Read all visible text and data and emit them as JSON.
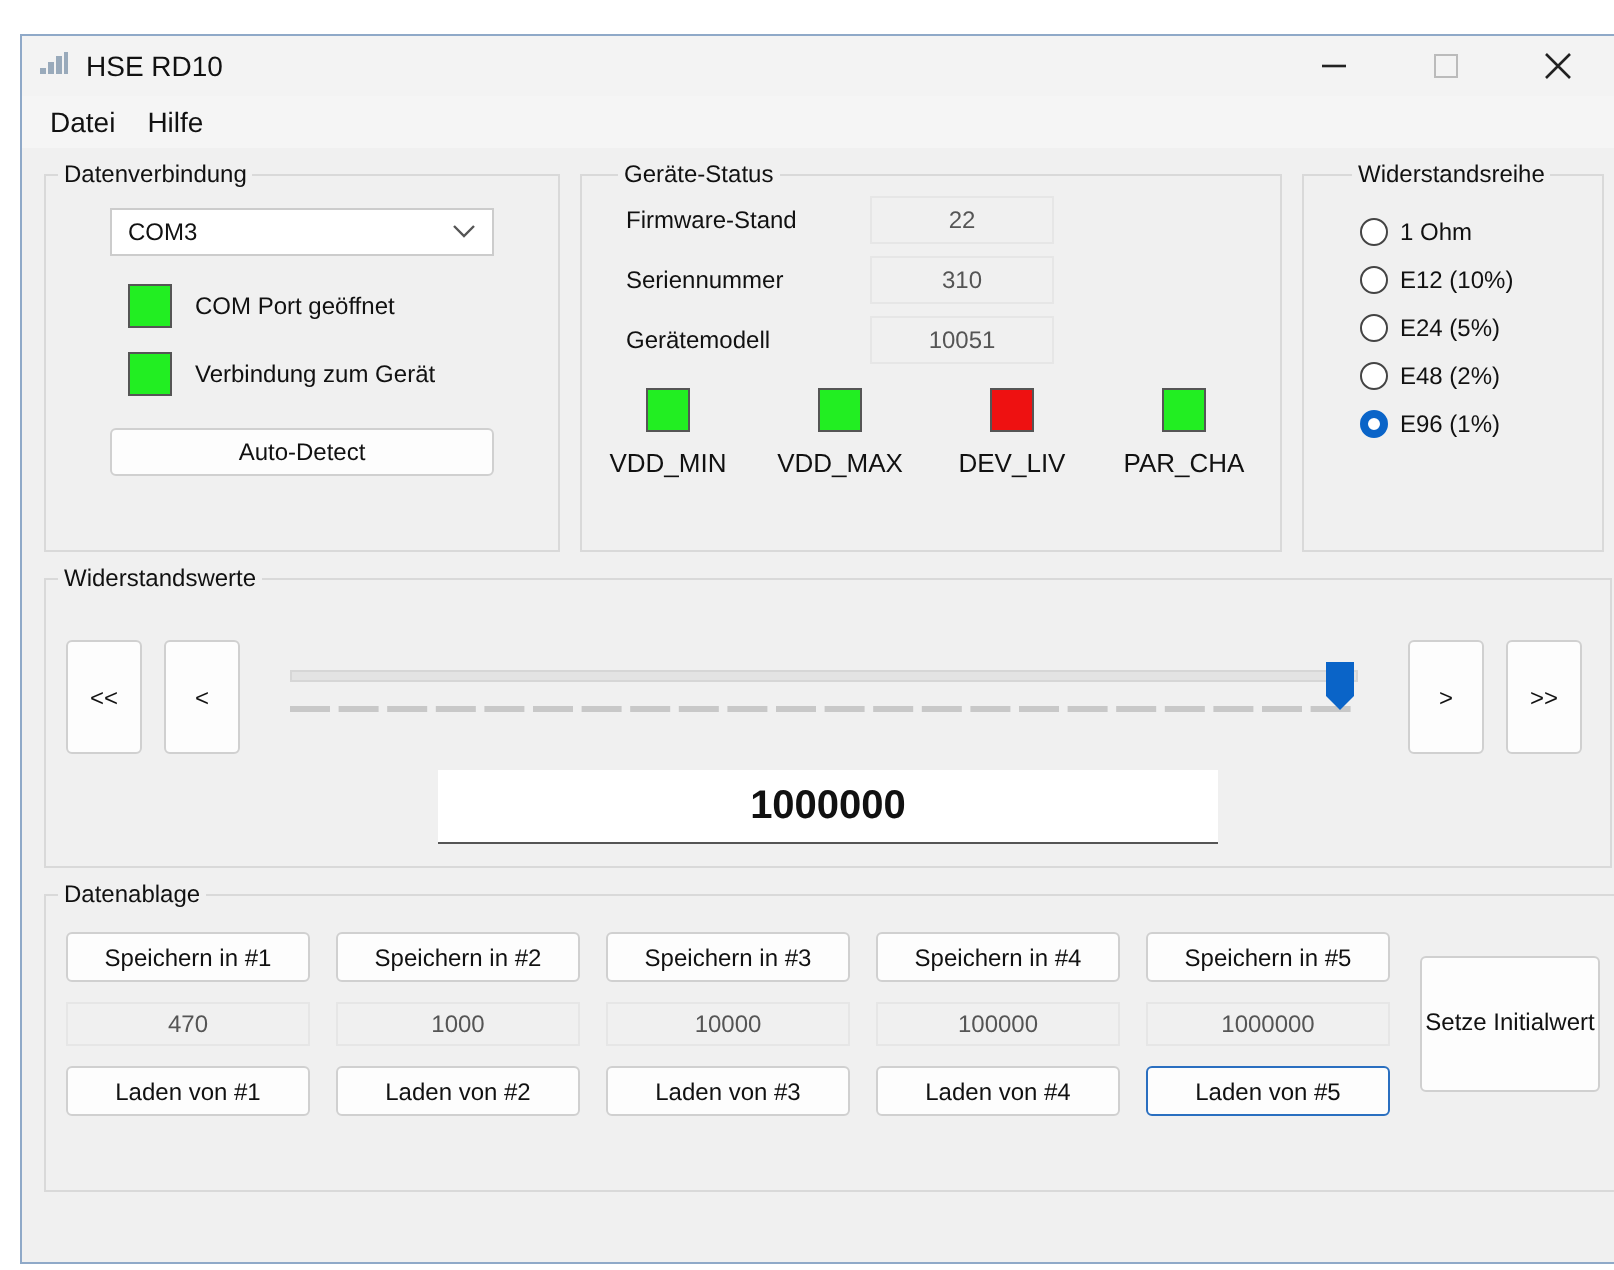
{
  "window": {
    "title": "HSE RD10"
  },
  "menu": [
    "Datei",
    "Hilfe"
  ],
  "datenverbindung": {
    "title": "Datenverbindung",
    "port": {
      "value": "COM3"
    },
    "indicators": [
      {
        "label": "COM Port geöffnet",
        "color": "#22ee22"
      },
      {
        "label": "Verbindung zum Gerät",
        "color": "#22ee22"
      }
    ],
    "button": "Auto-Detect"
  },
  "geraete_status": {
    "title": "Geräte-Status",
    "fields": [
      {
        "label": "Firmware-Stand",
        "value": "22"
      },
      {
        "label": "Seriennummer",
        "value": "310"
      },
      {
        "label": "Gerätemodell",
        "value": "10051"
      }
    ],
    "flags": [
      {
        "label": "VDD_MIN",
        "color": "#22ee22"
      },
      {
        "label": "VDD_MAX",
        "color": "#22ee22"
      },
      {
        "label": "DEV_LIV",
        "color": "#ee1111"
      },
      {
        "label": "PAR_CHA",
        "color": "#22ee22"
      }
    ]
  },
  "widerstandsreihe": {
    "title": "Widerstandsreihe",
    "options": [
      {
        "label": "1 Ohm",
        "selected": false
      },
      {
        "label": "E12 (10%)",
        "selected": false
      },
      {
        "label": "E24 (5%)",
        "selected": false
      },
      {
        "label": "E48 (2%)",
        "selected": false
      },
      {
        "label": "E96 (1%)",
        "selected": true
      }
    ]
  },
  "widerstandswerte": {
    "title": "Widerstandswerte",
    "left_buttons": [
      "<<",
      "<"
    ],
    "slider": {
      "level": 1
    },
    "right_buttons": [
      ">",
      ">>"
    ],
    "value": "1000000"
  },
  "datenablage": {
    "title": "Datenablage",
    "slots": [
      {
        "save": "Speichern in #1",
        "value": "470",
        "load": "Laden von #1",
        "focused": false
      },
      {
        "save": "Speichern in #2",
        "value": "1000",
        "load": "Laden von #2",
        "focused": false
      },
      {
        "save": "Speichern in #3",
        "value": "10000",
        "load": "Laden von #3",
        "focused": false
      },
      {
        "save": "Speichern in #4",
        "value": "100000",
        "load": "Laden von #4",
        "focused": false
      },
      {
        "save": "Speichern in #5",
        "value": "1000000",
        "load": "Laden von #5",
        "focused": true
      }
    ],
    "initial_button": "Setze Initialwert"
  }
}
